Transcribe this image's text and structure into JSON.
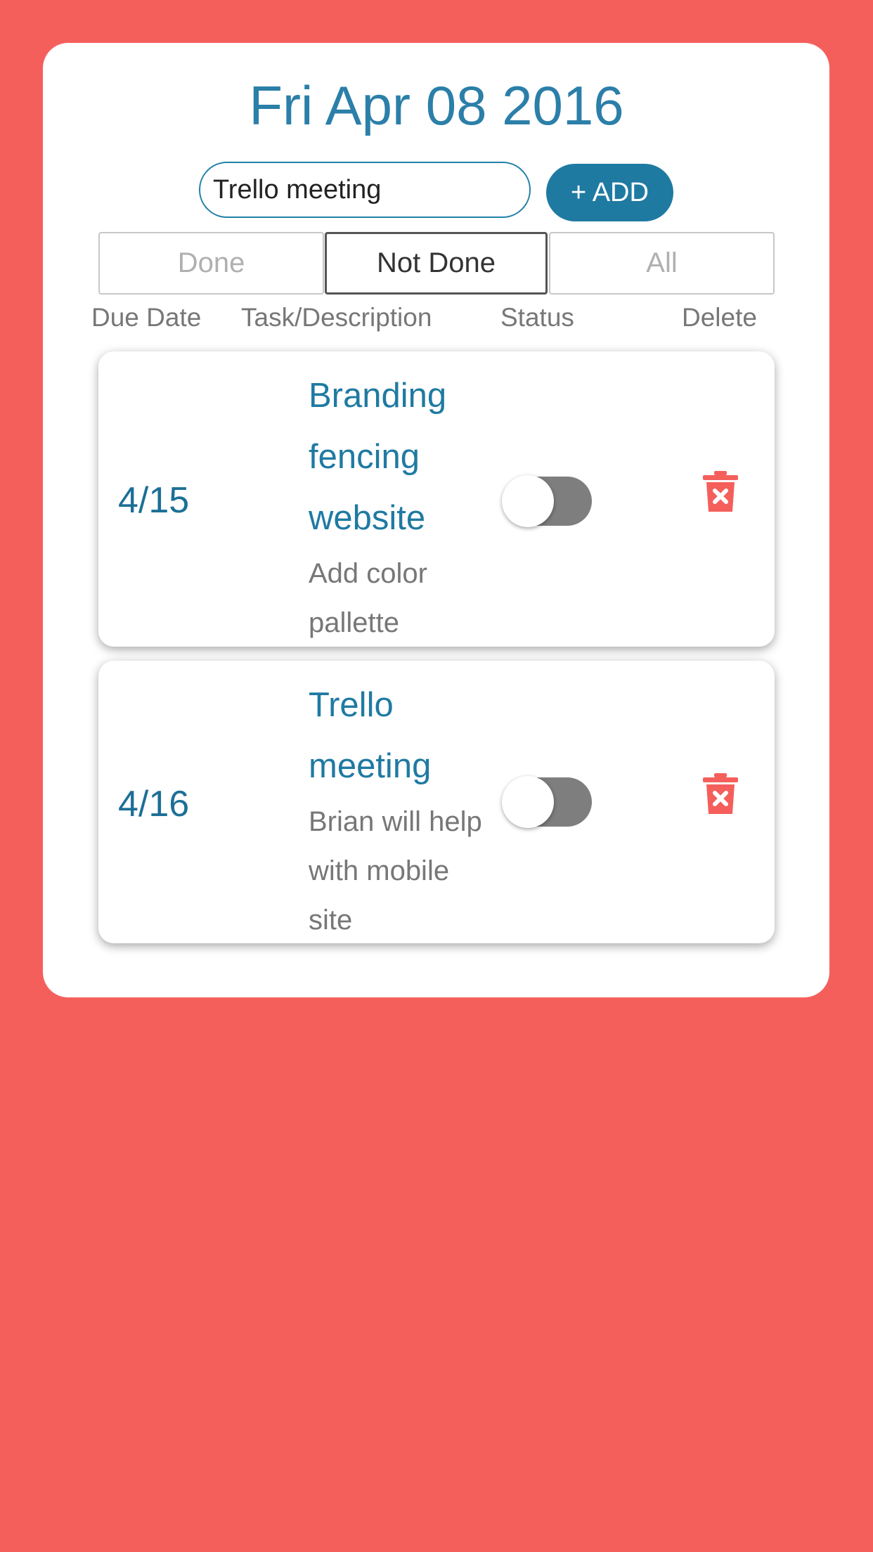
{
  "header": {
    "date": "Fri Apr 08 2016"
  },
  "new_task": {
    "value": "Trello meeting",
    "add_label": "+ ADD"
  },
  "filters": {
    "done": "Done",
    "not_done": "Not Done",
    "all": "All",
    "selected": "Not Done"
  },
  "columns": {
    "due": "Due Date",
    "task": "Task/Description",
    "status": "Status",
    "delete": "Delete"
  },
  "tasks": [
    {
      "due": "4/15",
      "title": "Branding fencing website",
      "description": "Add color pallette",
      "done": false
    },
    {
      "due": "4/16",
      "title": "Trello meeting",
      "description": "Brian will help with mobile site",
      "done": false
    }
  ],
  "colors": {
    "background": "#f55f5b",
    "accent": "#1f7aa2",
    "delete": "#f55f5b"
  },
  "icons": {
    "delete": "trash-x-icon"
  }
}
